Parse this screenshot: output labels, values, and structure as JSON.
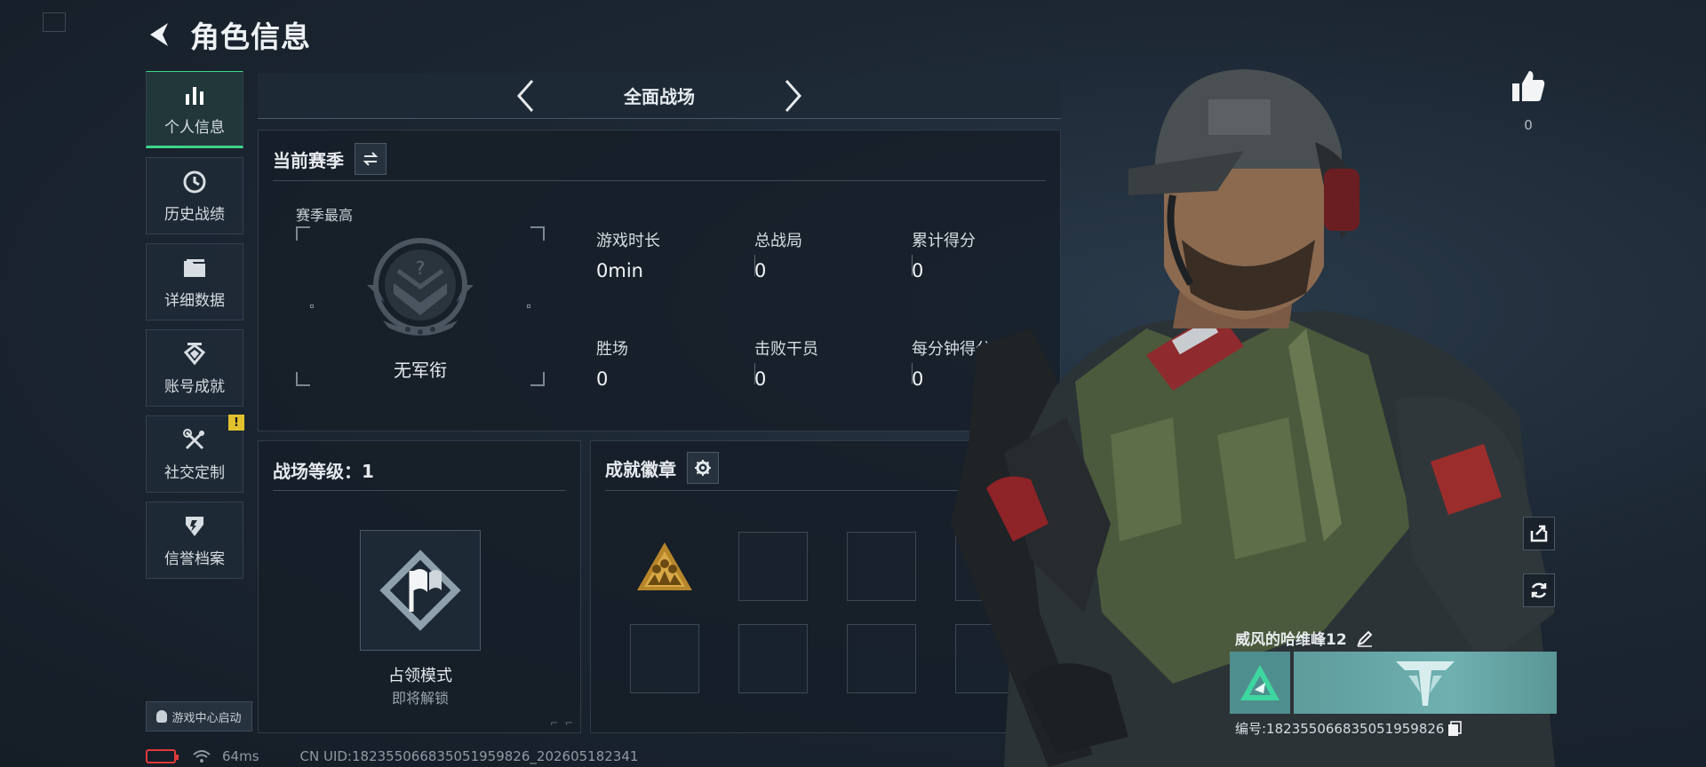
{
  "header": {
    "title": "角色信息"
  },
  "nav": {
    "items": [
      {
        "label": "个人信息",
        "icon": "bar-chart-icon",
        "active": true
      },
      {
        "label": "历史战绩",
        "icon": "clock-icon"
      },
      {
        "label": "详细数据",
        "icon": "folder-icon"
      },
      {
        "label": "账号成就",
        "icon": "achievement-icon"
      },
      {
        "label": "社交定制",
        "icon": "tools-icon",
        "badge": "!"
      },
      {
        "label": "信誉档案",
        "icon": "shield-icon"
      }
    ],
    "launch_label": "游戏中心启动"
  },
  "mode": {
    "title": "全面战场"
  },
  "season": {
    "title": "当前赛季",
    "best_label": "赛季最高",
    "rank": "无军衔",
    "stats": [
      {
        "label": "游戏时长",
        "value": "0min"
      },
      {
        "label": "总战局",
        "value": "0"
      },
      {
        "label": "累计得分",
        "value": "0"
      },
      {
        "label": "胜场",
        "value": "0"
      },
      {
        "label": "击败干员",
        "value": "0"
      },
      {
        "label": "每分钟得分",
        "value": "0"
      }
    ]
  },
  "level": {
    "title": "战场等级：1",
    "mode_name": "占领模式",
    "mode_status": "即将解锁"
  },
  "badges": {
    "title": "成就徽章",
    "slots": 8
  },
  "profile": {
    "likes": "0",
    "name": "威风的哈维峰12",
    "uid": "编号:182355066835051959826"
  },
  "status": {
    "ping": "64ms",
    "uid_line": "CN UID:182355066835051959826_202605182341"
  },
  "colors": {
    "accent": "#3ed68a",
    "warning": "#e2c12e",
    "card": "#5e9c9c"
  }
}
